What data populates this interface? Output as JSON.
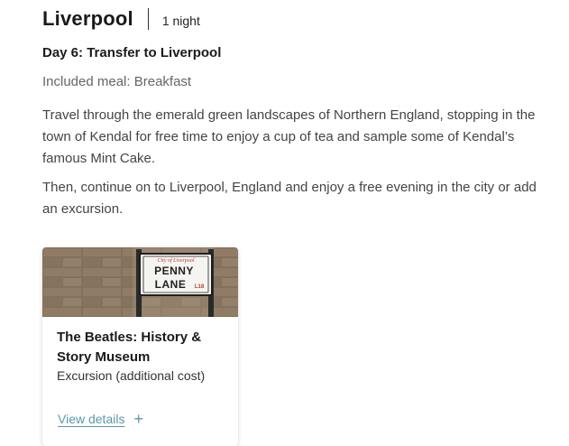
{
  "section": {
    "city": "Liverpool",
    "nights": "1 night"
  },
  "day": {
    "title": "Day 6: Transfer to Liverpool",
    "meal": "Included meal: Breakfast",
    "paragraphs": [
      "Travel through the emerald green landscapes of Northern England, stopping in the town of Kendal for free time to enjoy a cup of tea and sample some of Kendal’s famous Mint Cake.",
      "Then, continue on to Liverpool, England and enjoy a free evening in the city or add an excursion."
    ]
  },
  "excursion_card": {
    "sign": {
      "city_text": "City of Liverpool",
      "line1": "PENNY",
      "line2": "LANE",
      "postcode": "L18"
    },
    "title": "The Beatles: History & Story Museum",
    "subtitle": "Excursion (additional cost)",
    "link_label": "View details",
    "link_icon": "plus-icon"
  },
  "colors": {
    "link": "#5a9aa8",
    "meal_text": "#666666",
    "body_text": "#444444",
    "sign_red": "#c0392b"
  }
}
